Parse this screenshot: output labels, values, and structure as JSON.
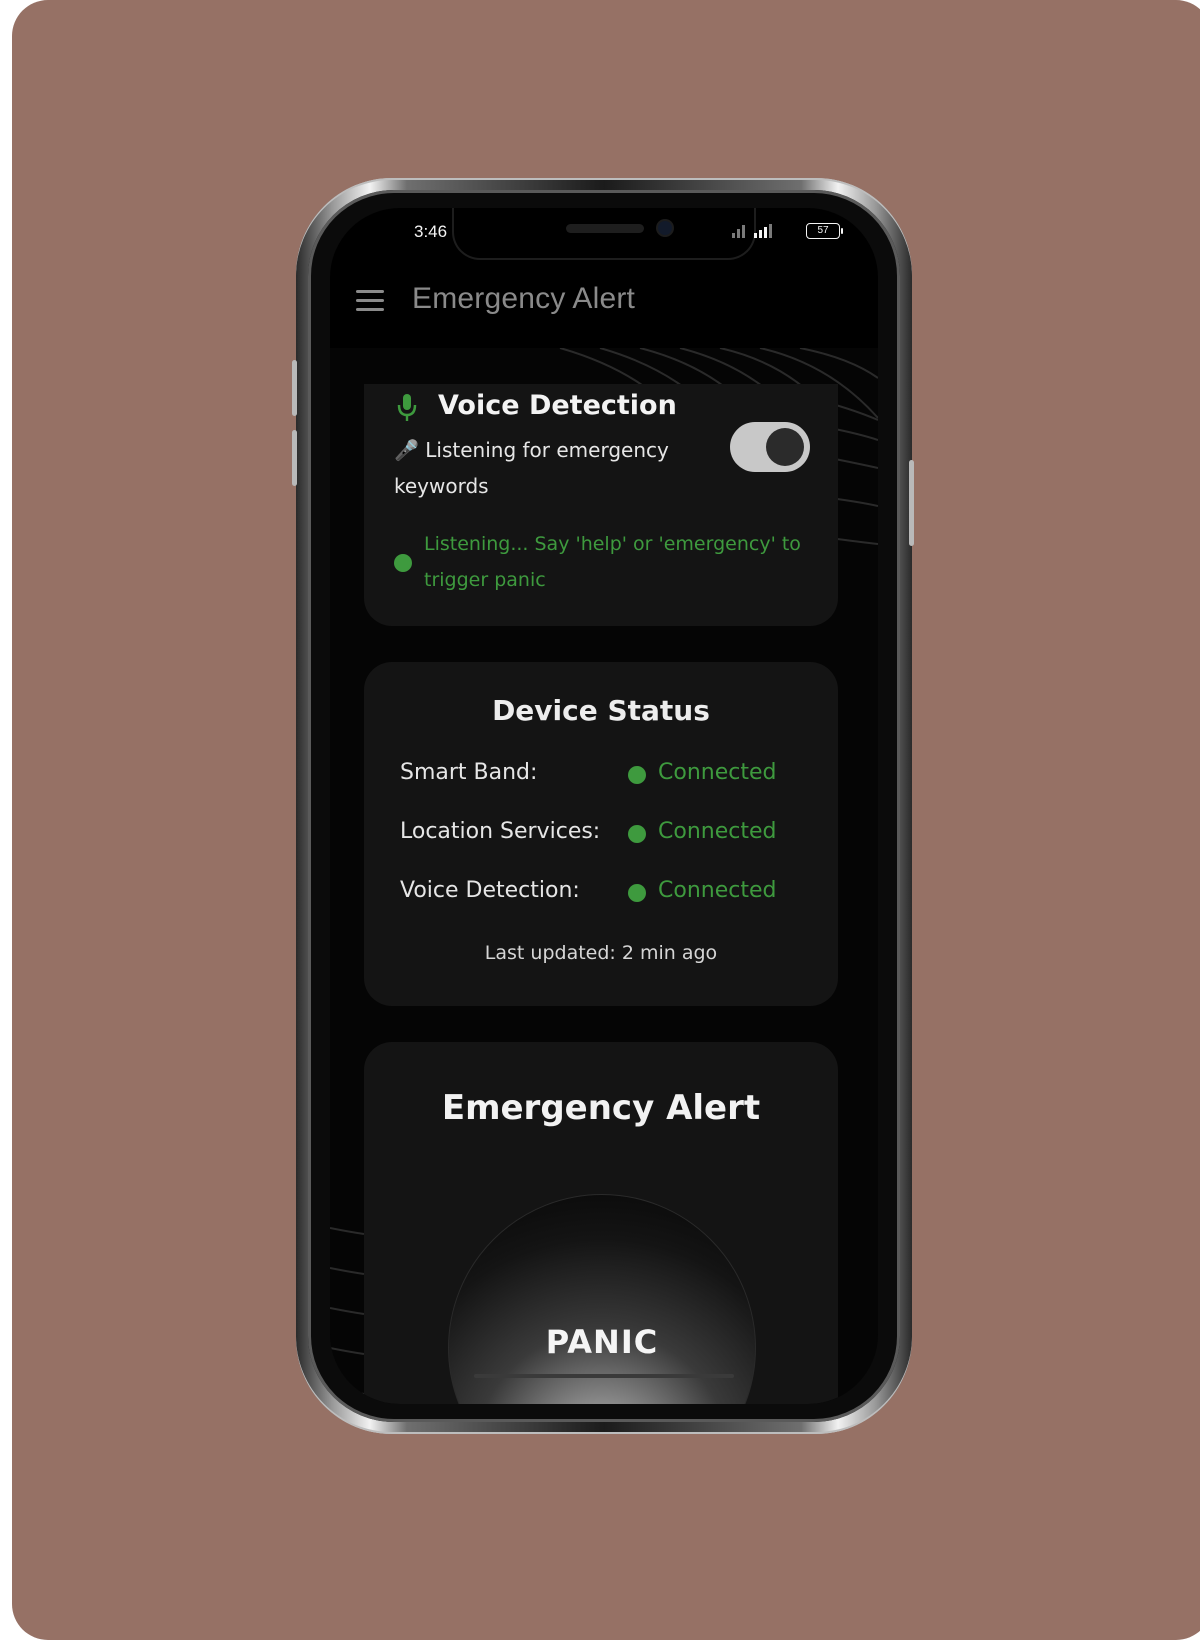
{
  "status_bar": {
    "time": "3:46",
    "battery": "57"
  },
  "app_bar": {
    "title": "Emergency Alert",
    "menu_icon": "hamburger-menu-icon"
  },
  "voice_detection": {
    "icon": "microphone-icon",
    "title": "Voice Detection",
    "description_emoji": "🎤",
    "description": "Listening for emergency keywords",
    "toggle_on": true,
    "status_text": "Listening... Say 'help' or 'emergency' to trigger panic"
  },
  "device_status": {
    "title": "Device Status",
    "rows": [
      {
        "label": "Smart Band:",
        "value": "Connected"
      },
      {
        "label": "Location Services:",
        "value": "Connected"
      },
      {
        "label": "Voice Detection:",
        "value": "Connected"
      }
    ],
    "last_updated": "Last updated: 2 min ago"
  },
  "emergency": {
    "title": "Emergency Alert",
    "panic_label": "PANIC"
  },
  "colors": {
    "background": "#967165",
    "accent_green": "#3e9a3e",
    "card": "#141414"
  }
}
